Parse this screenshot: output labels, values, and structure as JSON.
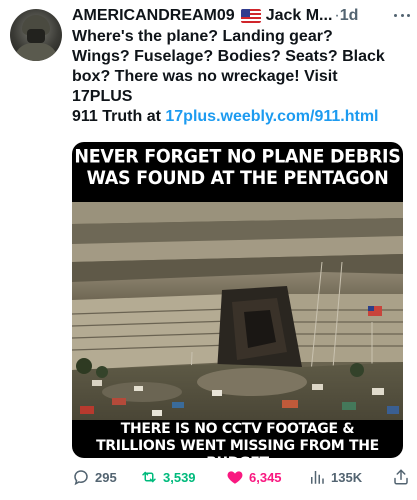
{
  "tweet": {
    "display_name": "AMERICANDREAM09",
    "flag_icon": "us-flag-icon",
    "alt_name": "Jack M...",
    "separator": "·",
    "time": "1d",
    "text_lines": [
      "Where's the plane? Landing gear?",
      "Wings? Fuselage? Bodies? Seats? Black",
      "box? There was no wreckage! Visit",
      "17PLUS"
    ],
    "text_last_prefix": "911 Truth at ",
    "text_link": "17plus.weebly.com/911.html"
  },
  "media": {
    "top_caption_lines": [
      "NEVER FORGET NO PLANE DEBRIS",
      "WAS FOUND AT THE PENTAGON"
    ],
    "bottom_caption_lines": [
      "THERE IS NO CCTV FOOTAGE &",
      "TRILLIONS WENT MISSING FROM THE BUDGET"
    ]
  },
  "actions": {
    "replies": "295",
    "reposts": "3,539",
    "likes": "6,345",
    "views": "135K",
    "colors": {
      "repost": "#00ba7c",
      "like": "#f91880",
      "link": "#1d9bf0",
      "muted": "#536471"
    }
  }
}
